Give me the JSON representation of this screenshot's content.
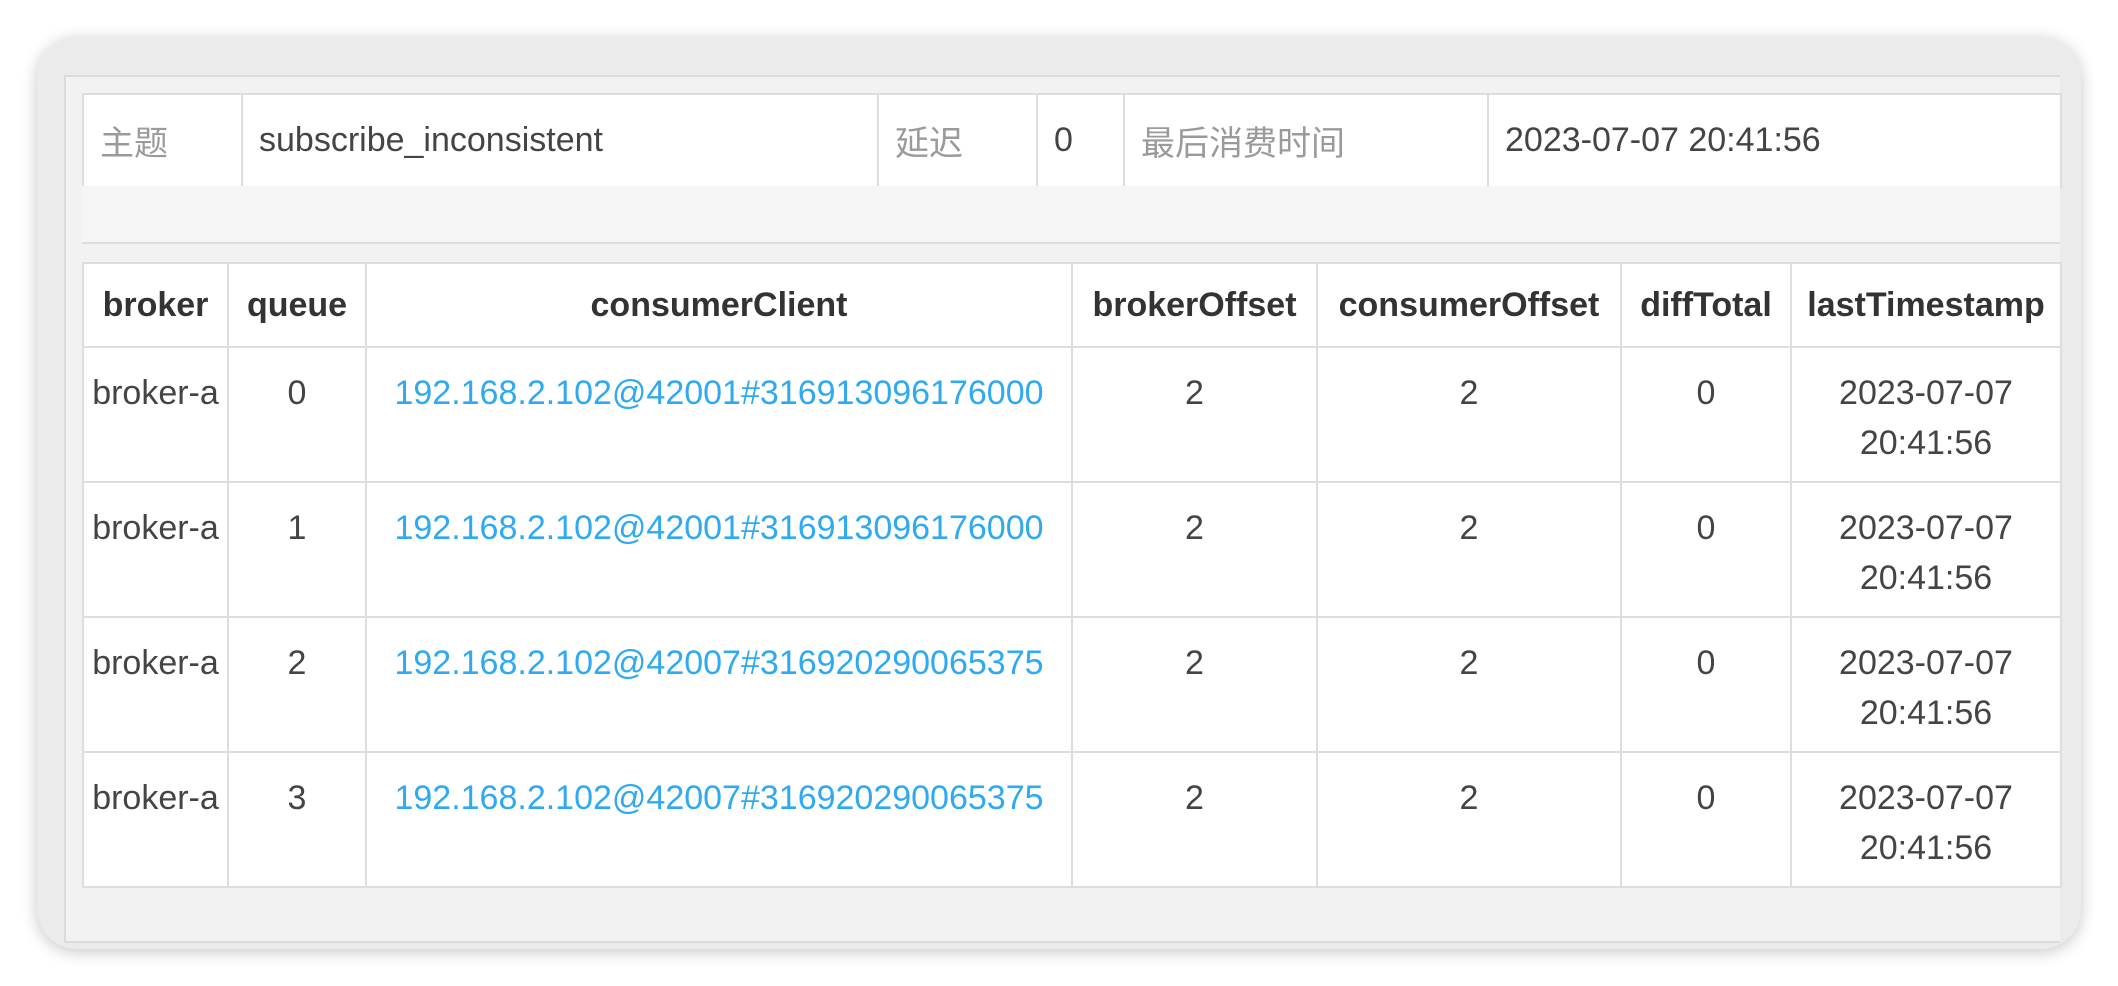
{
  "summary": {
    "topic_label": "主题",
    "topic_value": "subscribe_inconsistent",
    "delay_label": "延迟",
    "delay_value": "0",
    "last_consume_label": "最后消费时间",
    "last_consume_value": "2023-07-07 20:41:56"
  },
  "table": {
    "columns": [
      "broker",
      "queue",
      "consumerClient",
      "brokerOffset",
      "consumerOffset",
      "diffTotal",
      "lastTimestamp"
    ],
    "rows": [
      {
        "broker": "broker-a",
        "queue": "0",
        "consumerClient": "192.168.2.102@42001#316913096176000",
        "brokerOffset": "2",
        "consumerOffset": "2",
        "diffTotal": "0",
        "lastTimestamp": "2023-07-07 20:41:56"
      },
      {
        "broker": "broker-a",
        "queue": "1",
        "consumerClient": "192.168.2.102@42001#316913096176000",
        "brokerOffset": "2",
        "consumerOffset": "2",
        "diffTotal": "0",
        "lastTimestamp": "2023-07-07 20:41:56"
      },
      {
        "broker": "broker-a",
        "queue": "2",
        "consumerClient": "192.168.2.102@42007#316920290065375",
        "brokerOffset": "2",
        "consumerOffset": "2",
        "diffTotal": "0",
        "lastTimestamp": "2023-07-07 20:41:56"
      },
      {
        "broker": "broker-a",
        "queue": "3",
        "consumerClient": "192.168.2.102@42007#316920290065375",
        "brokerOffset": "2",
        "consumerOffset": "2",
        "diffTotal": "0",
        "lastTimestamp": "2023-07-07 20:41:56"
      }
    ]
  },
  "colors": {
    "link": "#2fa9f0",
    "label": "#9a9a9a",
    "border": "#dddddd",
    "window_bg": "#ebebeb"
  }
}
